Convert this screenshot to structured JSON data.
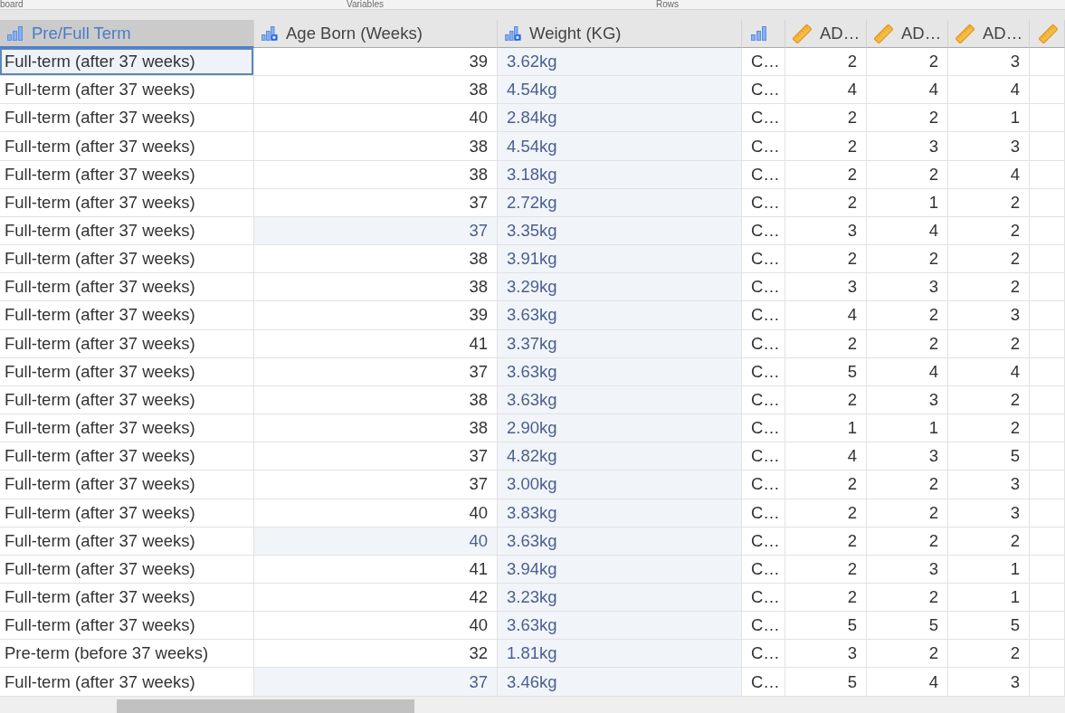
{
  "ribbon": {
    "group_labels": [
      "board",
      "Variables",
      "Rows"
    ]
  },
  "table": {
    "columns": [
      {
        "label": "Pre/Full Term",
        "kind": "nominal",
        "selected": true
      },
      {
        "label": "Age Born (Weeks)",
        "kind": "nominal-text",
        "selected": false
      },
      {
        "label": "Weight (KG)",
        "kind": "nominal-text",
        "selected": false
      },
      {
        "kind": "nominal",
        "selected": false
      },
      {
        "label": "AD…",
        "kind": "continuous",
        "selected": false
      },
      {
        "label": "AD…",
        "kind": "continuous",
        "selected": false
      },
      {
        "label": "AD…",
        "kind": "continuous",
        "selected": false
      },
      {
        "kind": "continuous",
        "selected": false
      }
    ],
    "rows": [
      {
        "selected": true,
        "cells": [
          {
            "text": "Full-term (after 37 weeks)",
            "shaded": false
          },
          {
            "text": "39",
            "shaded": false
          },
          {
            "text": "3.62kg",
            "shaded": true
          },
          {
            "text": "C…",
            "shaded": false
          },
          {
            "text": "2",
            "shaded": false
          },
          {
            "text": "2",
            "shaded": false
          },
          {
            "text": "3",
            "shaded": false
          }
        ]
      },
      {
        "selected": false,
        "cells": [
          {
            "text": "Full-term (after 37 weeks)",
            "shaded": false
          },
          {
            "text": "38",
            "shaded": false
          },
          {
            "text": "4.54kg",
            "shaded": true
          },
          {
            "text": "C…",
            "shaded": false
          },
          {
            "text": "4",
            "shaded": false
          },
          {
            "text": "4",
            "shaded": false
          },
          {
            "text": "4",
            "shaded": false
          }
        ]
      },
      {
        "selected": false,
        "cells": [
          {
            "text": "Full-term (after 37 weeks)",
            "shaded": false
          },
          {
            "text": "40",
            "shaded": false
          },
          {
            "text": "2.84kg",
            "shaded": true
          },
          {
            "text": "C…",
            "shaded": false
          },
          {
            "text": "2",
            "shaded": false
          },
          {
            "text": "2",
            "shaded": false
          },
          {
            "text": "1",
            "shaded": false
          }
        ]
      },
      {
        "selected": false,
        "cells": [
          {
            "text": "Full-term (after 37 weeks)",
            "shaded": false
          },
          {
            "text": "38",
            "shaded": false
          },
          {
            "text": "4.54kg",
            "shaded": true
          },
          {
            "text": "C…",
            "shaded": false
          },
          {
            "text": "2",
            "shaded": false
          },
          {
            "text": "3",
            "shaded": false
          },
          {
            "text": "3",
            "shaded": false
          }
        ]
      },
      {
        "selected": false,
        "cells": [
          {
            "text": "Full-term (after 37 weeks)",
            "shaded": false
          },
          {
            "text": "38",
            "shaded": false
          },
          {
            "text": "3.18kg",
            "shaded": true
          },
          {
            "text": "C…",
            "shaded": false
          },
          {
            "text": "2",
            "shaded": false
          },
          {
            "text": "2",
            "shaded": false
          },
          {
            "text": "4",
            "shaded": false
          }
        ]
      },
      {
        "selected": false,
        "cells": [
          {
            "text": "Full-term (after 37 weeks)",
            "shaded": false
          },
          {
            "text": "37",
            "shaded": false
          },
          {
            "text": "2.72kg",
            "shaded": true
          },
          {
            "text": "C…",
            "shaded": false
          },
          {
            "text": "2",
            "shaded": false
          },
          {
            "text": "1",
            "shaded": false
          },
          {
            "text": "2",
            "shaded": false
          }
        ]
      },
      {
        "selected": false,
        "cells": [
          {
            "text": "Full-term (after 37 weeks)",
            "shaded": false
          },
          {
            "text": "37",
            "shaded": true
          },
          {
            "text": "3.35kg",
            "shaded": true
          },
          {
            "text": "C…",
            "shaded": false
          },
          {
            "text": "3",
            "shaded": false
          },
          {
            "text": "4",
            "shaded": false
          },
          {
            "text": "2",
            "shaded": false
          }
        ]
      },
      {
        "selected": false,
        "cells": [
          {
            "text": "Full-term (after 37 weeks)",
            "shaded": false
          },
          {
            "text": "38",
            "shaded": false
          },
          {
            "text": "3.91kg",
            "shaded": true
          },
          {
            "text": "C…",
            "shaded": false
          },
          {
            "text": "2",
            "shaded": false
          },
          {
            "text": "2",
            "shaded": false
          },
          {
            "text": "2",
            "shaded": false
          }
        ]
      },
      {
        "selected": false,
        "cells": [
          {
            "text": "Full-term (after 37 weeks)",
            "shaded": false
          },
          {
            "text": "38",
            "shaded": false
          },
          {
            "text": "3.29kg",
            "shaded": true
          },
          {
            "text": "C…",
            "shaded": false
          },
          {
            "text": "3",
            "shaded": false
          },
          {
            "text": "3",
            "shaded": false
          },
          {
            "text": "2",
            "shaded": false
          }
        ]
      },
      {
        "selected": false,
        "cells": [
          {
            "text": "Full-term (after 37 weeks)",
            "shaded": false
          },
          {
            "text": "39",
            "shaded": false
          },
          {
            "text": "3.63kg",
            "shaded": true
          },
          {
            "text": "C…",
            "shaded": false
          },
          {
            "text": "4",
            "shaded": false
          },
          {
            "text": "2",
            "shaded": false
          },
          {
            "text": "3",
            "shaded": false
          }
        ]
      },
      {
        "selected": false,
        "cells": [
          {
            "text": "Full-term (after 37 weeks)",
            "shaded": false
          },
          {
            "text": "41",
            "shaded": false
          },
          {
            "text": "3.37kg",
            "shaded": true
          },
          {
            "text": "C…",
            "shaded": false
          },
          {
            "text": "2",
            "shaded": false
          },
          {
            "text": "2",
            "shaded": false
          },
          {
            "text": "2",
            "shaded": false
          }
        ]
      },
      {
        "selected": false,
        "cells": [
          {
            "text": "Full-term (after 37 weeks)",
            "shaded": false
          },
          {
            "text": "37",
            "shaded": false
          },
          {
            "text": "3.63kg",
            "shaded": true
          },
          {
            "text": "C…",
            "shaded": false
          },
          {
            "text": "5",
            "shaded": false
          },
          {
            "text": "4",
            "shaded": false
          },
          {
            "text": "4",
            "shaded": false
          }
        ]
      },
      {
        "selected": false,
        "cells": [
          {
            "text": "Full-term (after 37 weeks)",
            "shaded": false
          },
          {
            "text": "38",
            "shaded": false
          },
          {
            "text": "3.63kg",
            "shaded": true
          },
          {
            "text": "C…",
            "shaded": false
          },
          {
            "text": "2",
            "shaded": false
          },
          {
            "text": "3",
            "shaded": false
          },
          {
            "text": "2",
            "shaded": false
          }
        ]
      },
      {
        "selected": false,
        "cells": [
          {
            "text": "Full-term (after 37 weeks)",
            "shaded": false
          },
          {
            "text": "38",
            "shaded": false
          },
          {
            "text": "2.90kg",
            "shaded": true
          },
          {
            "text": "C…",
            "shaded": false
          },
          {
            "text": "1",
            "shaded": false
          },
          {
            "text": "1",
            "shaded": false
          },
          {
            "text": "2",
            "shaded": false
          }
        ]
      },
      {
        "selected": false,
        "cells": [
          {
            "text": "Full-term (after 37 weeks)",
            "shaded": false
          },
          {
            "text": "37",
            "shaded": false
          },
          {
            "text": "4.82kg",
            "shaded": true
          },
          {
            "text": "C…",
            "shaded": false
          },
          {
            "text": "4",
            "shaded": false
          },
          {
            "text": "3",
            "shaded": false
          },
          {
            "text": "5",
            "shaded": false
          }
        ]
      },
      {
        "selected": false,
        "cells": [
          {
            "text": "Full-term (after 37 weeks)",
            "shaded": false
          },
          {
            "text": "37",
            "shaded": false
          },
          {
            "text": "3.00kg",
            "shaded": true
          },
          {
            "text": "C…",
            "shaded": false
          },
          {
            "text": "2",
            "shaded": false
          },
          {
            "text": "2",
            "shaded": false
          },
          {
            "text": "3",
            "shaded": false
          }
        ]
      },
      {
        "selected": false,
        "cells": [
          {
            "text": "Full-term (after 37 weeks)",
            "shaded": false
          },
          {
            "text": "40",
            "shaded": false
          },
          {
            "text": "3.83kg",
            "shaded": true
          },
          {
            "text": "C…",
            "shaded": false
          },
          {
            "text": "2",
            "shaded": false
          },
          {
            "text": "2",
            "shaded": false
          },
          {
            "text": "3",
            "shaded": false
          }
        ]
      },
      {
        "selected": false,
        "cells": [
          {
            "text": "Full-term (after 37 weeks)",
            "shaded": false
          },
          {
            "text": "40",
            "shaded": true
          },
          {
            "text": "3.63kg",
            "shaded": true
          },
          {
            "text": "C…",
            "shaded": false
          },
          {
            "text": "2",
            "shaded": false
          },
          {
            "text": "2",
            "shaded": false
          },
          {
            "text": "2",
            "shaded": false
          }
        ]
      },
      {
        "selected": false,
        "cells": [
          {
            "text": "Full-term (after 37 weeks)",
            "shaded": false
          },
          {
            "text": "41",
            "shaded": false
          },
          {
            "text": "3.94kg",
            "shaded": true
          },
          {
            "text": "C…",
            "shaded": false
          },
          {
            "text": "2",
            "shaded": false
          },
          {
            "text": "3",
            "shaded": false
          },
          {
            "text": "1",
            "shaded": false
          }
        ]
      },
      {
        "selected": false,
        "cells": [
          {
            "text": "Full-term (after 37 weeks)",
            "shaded": false
          },
          {
            "text": "42",
            "shaded": false
          },
          {
            "text": "3.23kg",
            "shaded": true
          },
          {
            "text": "C…",
            "shaded": false
          },
          {
            "text": "2",
            "shaded": false
          },
          {
            "text": "2",
            "shaded": false
          },
          {
            "text": "1",
            "shaded": false
          }
        ]
      },
      {
        "selected": false,
        "cells": [
          {
            "text": "Full-term (after 37 weeks)",
            "shaded": false
          },
          {
            "text": "40",
            "shaded": false
          },
          {
            "text": "3.63kg",
            "shaded": true
          },
          {
            "text": "C…",
            "shaded": false
          },
          {
            "text": "5",
            "shaded": false
          },
          {
            "text": "5",
            "shaded": false
          },
          {
            "text": "5",
            "shaded": false
          }
        ]
      },
      {
        "selected": false,
        "cells": [
          {
            "text": "Pre-term (before 37 weeks)",
            "shaded": false
          },
          {
            "text": "32",
            "shaded": false
          },
          {
            "text": "1.81kg",
            "shaded": true
          },
          {
            "text": "C…",
            "shaded": false
          },
          {
            "text": "3",
            "shaded": false
          },
          {
            "text": "2",
            "shaded": false
          },
          {
            "text": "2",
            "shaded": false
          }
        ]
      },
      {
        "selected": false,
        "cells": [
          {
            "text": "Full-term (after 37 weeks)",
            "shaded": false
          },
          {
            "text": "37",
            "shaded": true
          },
          {
            "text": "3.46kg",
            "shaded": true
          },
          {
            "text": "C…",
            "shaded": false
          },
          {
            "text": "5",
            "shaded": false
          },
          {
            "text": "4",
            "shaded": false
          },
          {
            "text": "3",
            "shaded": false
          }
        ]
      }
    ]
  }
}
